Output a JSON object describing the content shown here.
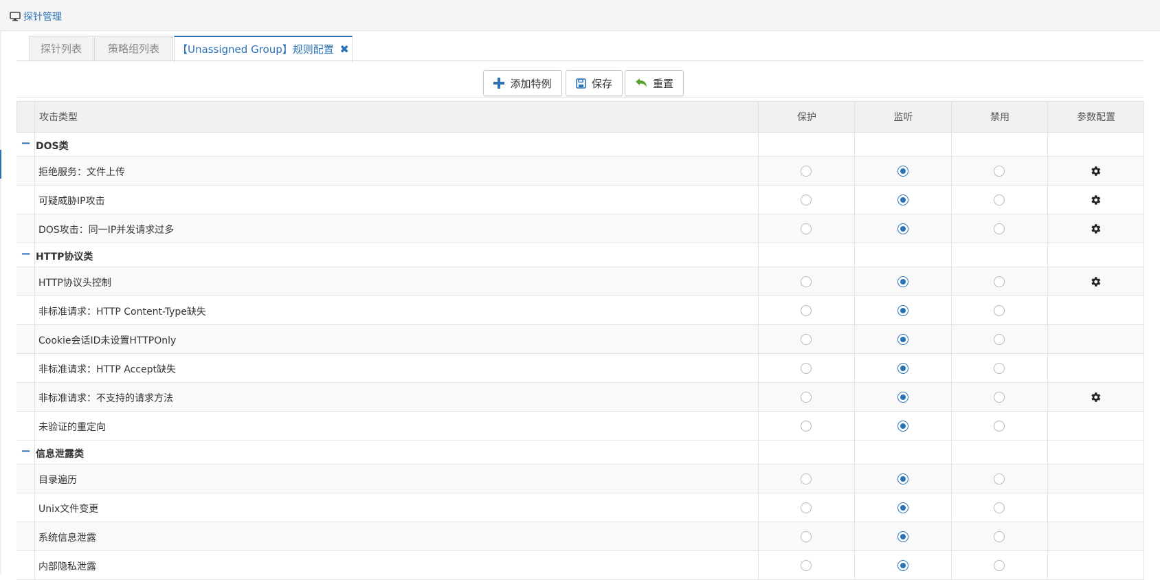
{
  "breadcrumb": {
    "label": "探针管理",
    "icon": "monitor-icon"
  },
  "tabs": [
    {
      "label": "探针列表",
      "active": false
    },
    {
      "label": "策略组列表",
      "active": false
    },
    {
      "label": "【Unassigned Group】规则配置",
      "active": true,
      "closable": true
    }
  ],
  "toolbar": {
    "add_label": "添加特例",
    "save_label": "保存",
    "reset_label": "重置"
  },
  "table": {
    "columns": [
      "攻击类型",
      "保护",
      "监听",
      "禁用",
      "参数配置"
    ],
    "groups": [
      {
        "name": "DOS类",
        "rows": [
          {
            "name": "拒绝服务：文件上传",
            "mode": "监听",
            "config": true
          },
          {
            "name": "可疑威胁IP攻击",
            "mode": "监听",
            "config": true
          },
          {
            "name": "DOS攻击：同一IP并发请求过多",
            "mode": "监听",
            "config": true
          }
        ]
      },
      {
        "name": "HTTP协议类",
        "rows": [
          {
            "name": "HTTP协议头控制",
            "mode": "监听",
            "config": true
          },
          {
            "name": "非标准请求：HTTP Content-Type缺失",
            "mode": "监听",
            "config": false
          },
          {
            "name": "Cookie会话ID未设置HTTPOnly",
            "mode": "监听",
            "config": false
          },
          {
            "name": "非标准请求：HTTP Accept缺失",
            "mode": "监听",
            "config": false
          },
          {
            "name": "非标准请求：不支持的请求方法",
            "mode": "监听",
            "config": true
          },
          {
            "name": "未验证的重定向",
            "mode": "监听",
            "config": false
          }
        ]
      },
      {
        "name": "信息泄露类",
        "rows": [
          {
            "name": "目录遍历",
            "mode": "监听",
            "config": false
          },
          {
            "name": "Unix文件变更",
            "mode": "监听",
            "config": false
          },
          {
            "name": "系统信息泄露",
            "mode": "监听",
            "config": false
          },
          {
            "name": "内部隐私泄露",
            "mode": "监听",
            "config": false
          }
        ]
      }
    ]
  },
  "colors": {
    "accent": "#2a72b5",
    "reset_icon": "#5aa02c"
  }
}
